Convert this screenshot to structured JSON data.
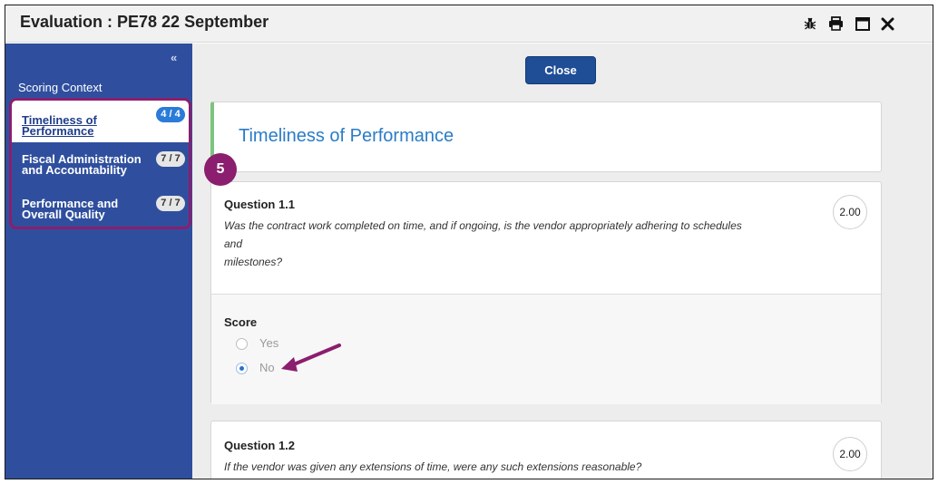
{
  "window": {
    "title": "Evaluation : PE78 22 September",
    "icons": [
      "bug-icon",
      "print-icon",
      "maximize-icon",
      "close-icon"
    ]
  },
  "sidebar": {
    "collapse_glyph": "«",
    "heading": "Scoring Context",
    "items": [
      {
        "label": "Timeliness of Performance",
        "badge": "4 / 4",
        "active": true
      },
      {
        "label": "Fiscal Administration and Accountability",
        "badge": "7 / 7",
        "active": false
      },
      {
        "label": "Performance and Overall Quality",
        "badge": "7 / 7",
        "active": false
      }
    ],
    "step_marker": "5"
  },
  "main": {
    "close_label": "Close",
    "section_title": "Timeliness of Performance",
    "questions": [
      {
        "title": "Question 1.1",
        "text_lines": [
          "Was the contract work completed on time, and if ongoing, is the vendor appropriately adhering to schedules",
          "and",
          "milestones?"
        ],
        "points": "2.00",
        "score_label": "Score",
        "options": [
          "Yes",
          "No"
        ],
        "selected": "No"
      },
      {
        "title": "Question 1.2",
        "text_lines": [
          "If the vendor was given any extensions of time, were any such extensions reasonable?"
        ],
        "points": "2.00"
      }
    ]
  },
  "colors": {
    "sidebar": "#2f4f9e",
    "highlight": "#8b1e6e",
    "accent_blue": "#2a7cc7",
    "close_button": "#1f4e96"
  }
}
